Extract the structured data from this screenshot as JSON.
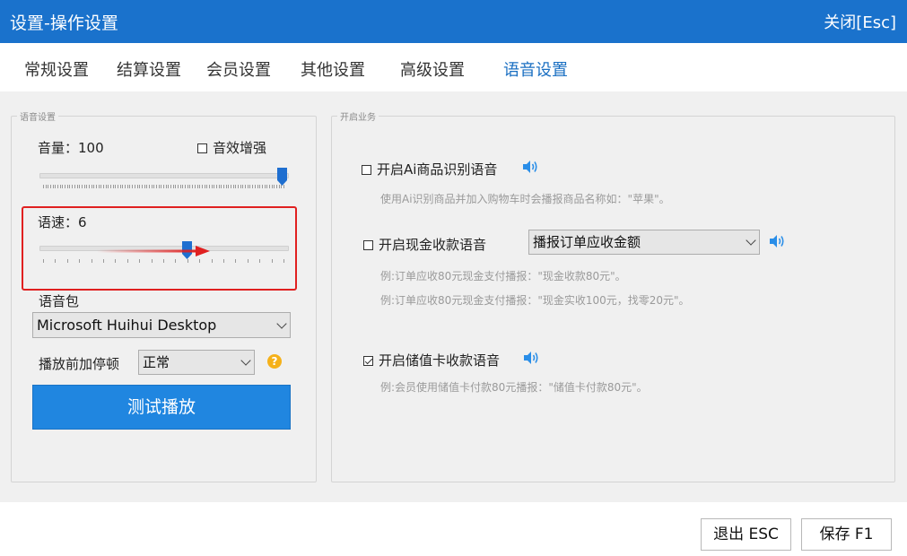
{
  "window": {
    "title": "设置-操作设置",
    "close_label": "关闭[Esc]"
  },
  "tabs": [
    {
      "label": "常规设置",
      "active": false
    },
    {
      "label": "结算设置",
      "active": false
    },
    {
      "label": "会员设置",
      "active": false
    },
    {
      "label": "其他设置",
      "active": false
    },
    {
      "label": "高级设置",
      "active": false
    },
    {
      "label": "语音设置",
      "active": true
    }
  ],
  "voice_settings": {
    "group_title": "语音设置",
    "volume_label": "音量：100",
    "volume_value": 100,
    "volume_max": 100,
    "enhance_label": "音效增强",
    "enhance_checked": false,
    "speed_label": "语速：6",
    "speed_value": 6,
    "speed_max": 10,
    "voice_pack_label": "语音包",
    "voice_pack_value": "Microsoft Huihui Desktop",
    "pause_label": "播放前加停顿",
    "pause_value": "正常",
    "help_icon": "?",
    "test_button": "测试播放"
  },
  "business": {
    "group_title": "开启业务",
    "items": [
      {
        "label": "开启Ai商品识别语音",
        "checked": false,
        "desc": [
          "使用Ai识别商品并加入购物车时会播报商品名称如：\"苹果\"。"
        ]
      },
      {
        "label": "开启现金收款语音",
        "checked": false,
        "select": "播报订单应收金额",
        "desc": [
          "例:订单应收80元现金支付播报：\"现金收款80元\"。",
          "例:订单应收80元现金支付播报：\"现金实收100元，找零20元\"。"
        ]
      },
      {
        "label": "开启储值卡收款语音",
        "checked": true,
        "desc": [
          "例:会员使用储值卡付款80元播报：\"储值卡付款80元\"。"
        ]
      }
    ]
  },
  "footer": {
    "exit_label": "退出 ESC",
    "save_label": "保存 F1"
  },
  "colors": {
    "accent": "#1a72cc",
    "highlight": "#e02020"
  }
}
